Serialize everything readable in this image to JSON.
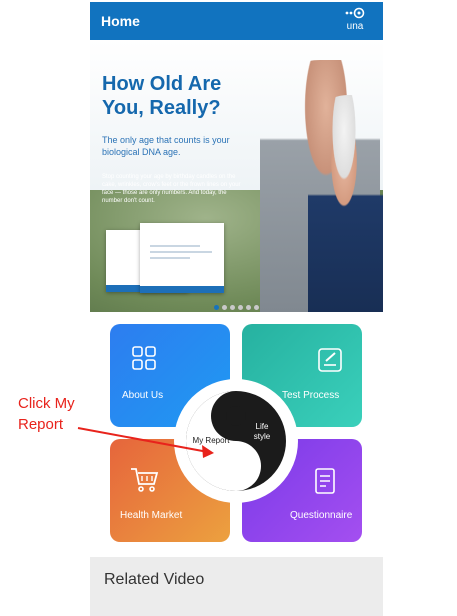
{
  "header": {
    "title": "Home",
    "logo_text": "una"
  },
  "banner": {
    "headline": "How Old Are You, Really?",
    "subline": "The only age that counts is your biological DNA age.",
    "body": "Stop counting your age by birthday candles on the cake, wrinkles, crow's feet or the frown lines on your face — those are only numbers. And today, the number don't count.",
    "active_slide": 1,
    "slide_count": 6
  },
  "tiles": {
    "about": "About Us",
    "test": "Test Process",
    "health": "Health Market",
    "questionnaire": "Questionnaire"
  },
  "center": {
    "report": "My Report",
    "life": "Life style"
  },
  "related": {
    "title": "Related Video"
  },
  "annotation": {
    "text": "Click My Report",
    "color": "#e8231c"
  },
  "colors": {
    "header": "#1173bf",
    "about": "#2d7df0",
    "test": "#26b1a0",
    "health": "#e6653c",
    "questionnaire": "#8a42ec"
  }
}
